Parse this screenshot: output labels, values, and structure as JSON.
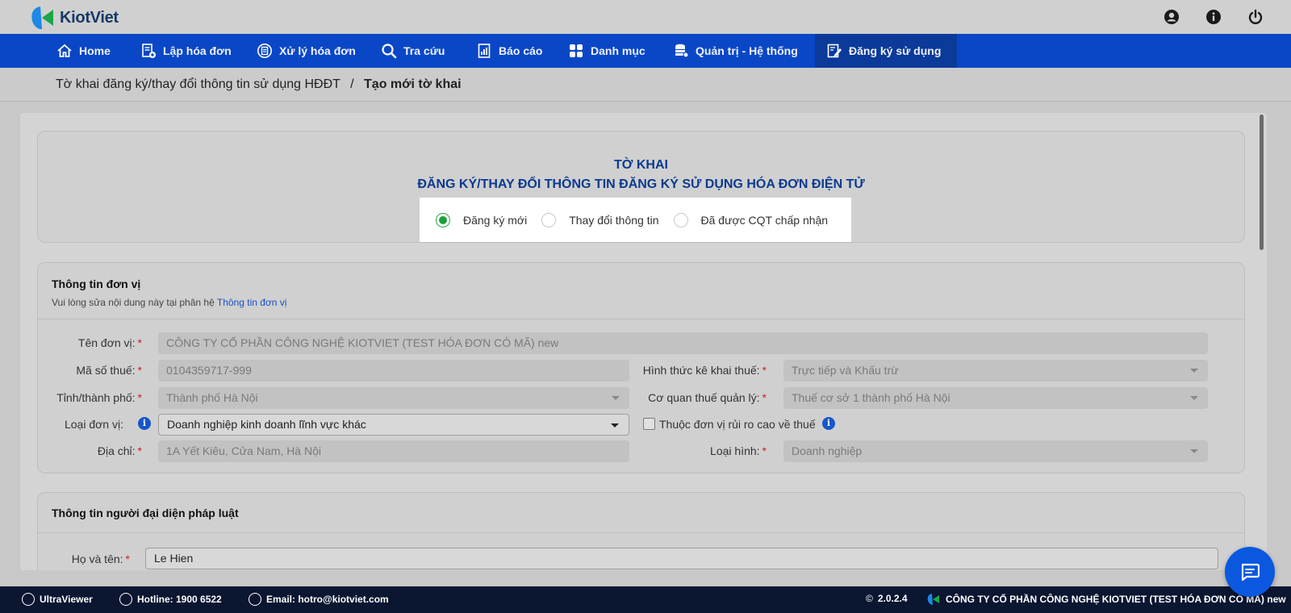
{
  "app": {
    "name": "KiotViet",
    "brand_color": "#0a47c7",
    "top_icons": [
      "user-icon",
      "info-icon",
      "power-icon"
    ]
  },
  "nav": {
    "items": [
      {
        "label": "Home",
        "icon": "home-icon"
      },
      {
        "label": "Lập hóa đơn",
        "icon": "invoice-add-icon"
      },
      {
        "label": "Xử lý hóa đơn",
        "icon": "invoice-process-icon"
      },
      {
        "label": "Tra cứu",
        "icon": "search-icon"
      },
      {
        "label": "Báo cáo",
        "icon": "report-icon"
      },
      {
        "label": "Danh mục",
        "icon": "grid-icon"
      },
      {
        "label": "Quản trị - Hệ thống",
        "icon": "database-icon"
      },
      {
        "label": "Đăng ký sử dụng",
        "icon": "register-icon"
      }
    ],
    "active": "Đăng ký sử dụng"
  },
  "breadcrumb": {
    "parent": "Tờ khai đăng ký/thay đổi thông tin sử dụng HĐĐT",
    "separator": "/",
    "current": "Tạo mới tờ khai"
  },
  "declaration": {
    "title": "TỜ KHAI",
    "subtitle": "ĐĂNG KÝ/THAY ĐỔI THÔNG TIN ĐĂNG KÝ SỬ DỤNG HÓA ĐƠN ĐIỆN TỬ",
    "options": [
      "Đăng ký mới",
      "Thay đổi thông tin",
      "Đã được CQT chấp nhận"
    ],
    "selected": "Đăng ký mới"
  },
  "unit_info": {
    "title": "Thông tin đơn vị",
    "note": "Vui lòng sửa nội dung này tại phân hệ",
    "note_link": "Thông tin đơn vị",
    "required_mark": "*",
    "fields": {
      "unit_name": {
        "label": "Tên đơn vị:",
        "value": "CÔNG TY CỔ PHẦN CÔNG NGHỆ KIOTVIET (TEST HÓA ĐƠN CÓ MÃ) new"
      },
      "tax_code": {
        "label": "Mã số thuế:",
        "value": "0104359717-999"
      },
      "tax_method": {
        "label": "Hình thức kê khai thuế:",
        "value": "Trực tiếp và Khấu trừ"
      },
      "province": {
        "label": "Tỉnh/thành phố:",
        "value": "Thành phố Hà Nội"
      },
      "tax_authority": {
        "label": "Cơ quan thuế quản lý:",
        "value": "Thuế cơ sở 1 thành phố Hà Nội"
      },
      "unit_type": {
        "label": "Loại đơn vị:",
        "value": "Doanh nghiệp kinh doanh lĩnh vực khác"
      },
      "high_risk": {
        "label": "Thuộc đơn vị rủi ro cao về thuế",
        "checked": false
      },
      "address": {
        "label": "Địa chỉ:",
        "value": "1A Yết Kiêu, Cửa Nam, Hà Nội"
      },
      "business_form": {
        "label": "Loại hình:",
        "value": "Doanh nghiệp"
      }
    }
  },
  "legal_rep": {
    "title": "Thông tin người đại diện pháp luật",
    "name_label": "Họ và tên:",
    "name_value": "Le Hien"
  },
  "footer": {
    "ultraviewer": "UltraViewer",
    "hotline": "Hotline: 1900 6522",
    "email": "Email: hotro@kiotviet.com",
    "version_mark": "©",
    "version": "2.0.2.4",
    "company": "CÔNG TY CỔ PHẦN CÔNG NGHỆ KIOTVIET (TEST HÓA ĐƠN CÓ MÃ) new"
  }
}
